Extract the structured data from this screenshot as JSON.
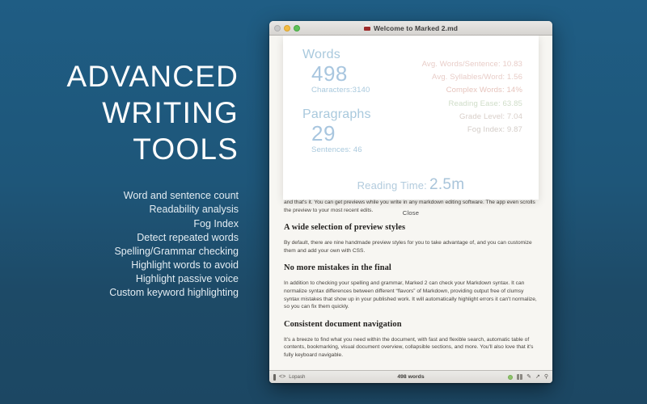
{
  "promo": {
    "title_lines": [
      "ADVANCED",
      "WRITING",
      "TOOLS"
    ],
    "features": [
      "Word and sentence count",
      "Readability analysis",
      "Fog Index",
      "Detect repeated words",
      "Spelling/Grammar checking",
      "Highlight words to avoid",
      "Highlight passive voice",
      "Custom keyword highlighting"
    ]
  },
  "window": {
    "title": "Welcome to Marked 2.md",
    "doc_icon": "document-icon",
    "traffic_lights": [
      "close",
      "minimize",
      "zoom"
    ]
  },
  "stats_modal": {
    "left_blocks": [
      {
        "label": "Words",
        "value": "498",
        "sub": "Characters:3140"
      },
      {
        "label": "Paragraphs",
        "value": "29",
        "sub": "Sentences: 46"
      }
    ],
    "right_lines": [
      {
        "text": "Avg. Words/Sentence: 10.83",
        "color": "#e8cdc8"
      },
      {
        "text": "Avg. Syllables/Word: 1.56",
        "color": "#e8cdc8"
      },
      {
        "text": "Complex Words: 14%",
        "color": "#e6c4bd"
      },
      {
        "text": "Reading Ease: 63.85",
        "color": "#cfddc8"
      },
      {
        "text": "Grade Level: 7.04",
        "color": "#d9cfc9"
      },
      {
        "text": "Fog Index: 9.87",
        "color": "#d4cdc8"
      }
    ],
    "reading_time_label": "Reading Time:",
    "reading_time_value": "2.5m",
    "close_label": "Close"
  },
  "document": {
    "blocks": [
      {
        "type": "p",
        "text": "and that's it. You can get previews while you write in any markdown editing software. The app even scrolls the preview to your most recent edits."
      },
      {
        "type": "h",
        "text": "A wide selection of preview styles"
      },
      {
        "type": "p",
        "text": "By default, there are nine handmade preview styles for you to take advantage of, and you can customize them and add your own with CSS."
      },
      {
        "type": "h",
        "text": "No more mistakes in the final"
      },
      {
        "type": "p",
        "text": "In addition to checking your spelling and grammar, Marked 2 can check your Markdown syntax. It can normalize syntax differences between different “flavors” of Markdown, providing output free of clumsy syntax mistakes that show up in your published work. It will automatically highlight errors it can't normalize, so you can fix them quickly."
      },
      {
        "type": "h",
        "text": "Consistent document navigation"
      },
      {
        "type": "p",
        "text": "It's a breeze to find what you need within the document, with fast and flexible search, automatic table of contents, bookmarking, visual document overview, collapsible sections, and more. You'll also love that it's fully keyboard navigable."
      }
    ]
  },
  "statusbar": {
    "style_name": "Lopash",
    "word_count": "498 words",
    "code_icon": "<>",
    "right_icons": [
      "status-dot",
      "columns-icon",
      "pencil-icon",
      "share-icon",
      "search-icon"
    ]
  },
  "colors": {
    "background_top": "#1f5d84",
    "background_bottom": "#1c4763",
    "accent_blue": "#a8c6df",
    "reading_ease_green": "#cfddc8"
  }
}
